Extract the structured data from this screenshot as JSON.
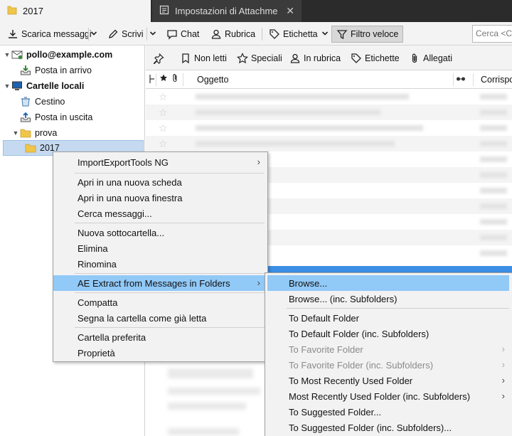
{
  "tabs": [
    {
      "label": "2017",
      "icon": "folder-icon"
    },
    {
      "label": "Impostazioni di Attachment",
      "icon": "settings-page-icon",
      "close": "✕"
    }
  ],
  "toolbar": {
    "get_messages": "Scarica messaggi",
    "write": "Scrivi",
    "chat": "Chat",
    "address_book": "Rubrica",
    "tag": "Etichetta",
    "quick_filter": "Filtro veloce",
    "search_placeholder": "Cerca <Ct"
  },
  "folders": {
    "account_email": "pollo@example.com",
    "inbox": "Posta in arrivo",
    "local_folders": "Cartelle locali",
    "trash": "Cestino",
    "outbox": "Posta in uscita",
    "prova": "prova",
    "folder_2017": "2017"
  },
  "quick_filter": {
    "unread": "Non letti",
    "starred": "Speciali",
    "contact": "In rubrica",
    "tags": "Etichette",
    "attachments": "Allegati"
  },
  "thread_columns": {
    "subject": "Oggetto",
    "correspondents": "Corrispo"
  },
  "context_menu": {
    "items": [
      {
        "label": "ImportExportTools NG"
      },
      {
        "label": "Apri in una nuova scheda"
      },
      {
        "label": "Apri in una nuova finestra"
      },
      {
        "label": "Cerca messaggi..."
      },
      {
        "label": "Nuova sottocartella..."
      },
      {
        "label": "Elimina"
      },
      {
        "label": "Rinomina"
      },
      {
        "label": "AE Extract from Messages in Folders"
      },
      {
        "label": "Compatta"
      },
      {
        "label": "Segna la cartella come già letta"
      },
      {
        "label": "Cartella preferita"
      },
      {
        "label": "Proprietà"
      }
    ]
  },
  "submenu": {
    "items": [
      {
        "label": "Browse..."
      },
      {
        "label": "Browse... (inc. Subfolders)"
      },
      {
        "label": "To Default Folder"
      },
      {
        "label": "To Default Folder (inc. Subfolders)"
      },
      {
        "label": "To Favorite Folder"
      },
      {
        "label": "To Favorite Folder (inc. Subfolders)"
      },
      {
        "label": "To Most Recently Used Folder"
      },
      {
        "label": "Most Recently Used Folder (inc. Subfolders)"
      },
      {
        "label": "To Suggested Folder..."
      },
      {
        "label": "To Suggested Folder (inc. Subfolders)..."
      }
    ]
  },
  "colors": {
    "menu_highlight": "#91c9f7",
    "selected_folder": "#c5daf0",
    "tabbar_bg": "#2b2b2b",
    "folder_yellow": "#f0c64a"
  }
}
